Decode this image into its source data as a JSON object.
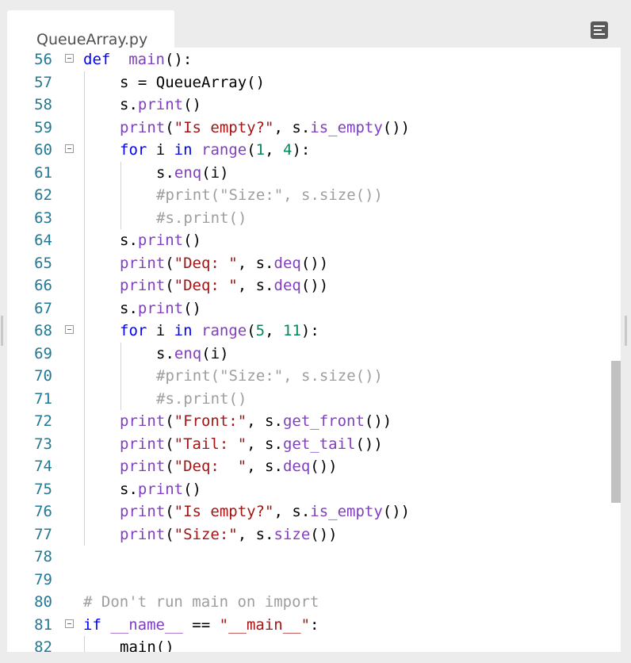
{
  "tab": {
    "filename": "QueueArray.py"
  },
  "menu": {
    "icon": "menu-lines-icon"
  },
  "colors": {
    "line_number": "#237893",
    "keyword": "#0000ff",
    "string": "#a31515",
    "number": "#098658",
    "member": "#7f3fbf",
    "comment": "#9e9e9e",
    "scrollbar_thumb": "#c1c1c1"
  },
  "code": {
    "lines": [
      {
        "n": "56",
        "fold": true,
        "indent": 0,
        "tokens": [
          [
            "kw",
            "def"
          ],
          [
            "",
            "  "
          ],
          [
            "mem",
            "main"
          ],
          [
            "",
            "():"
          ]
        ]
      },
      {
        "n": "57",
        "indent": 1,
        "tokens": [
          [
            "",
            "s = QueueArray()"
          ]
        ]
      },
      {
        "n": "58",
        "indent": 1,
        "tokens": [
          [
            "",
            "s."
          ],
          [
            "mem",
            "print"
          ],
          [
            "",
            "()"
          ]
        ]
      },
      {
        "n": "59",
        "indent": 1,
        "tokens": [
          [
            "mem",
            "print"
          ],
          [
            "",
            "("
          ],
          [
            "str",
            "\"Is empty?\""
          ],
          [
            "",
            ", s."
          ],
          [
            "mem",
            "is_empty"
          ],
          [
            "",
            "())"
          ]
        ]
      },
      {
        "n": "60",
        "fold": true,
        "indent": 1,
        "tokens": [
          [
            "kw",
            "for"
          ],
          [
            "",
            " i "
          ],
          [
            "kw",
            "in"
          ],
          [
            "",
            " "
          ],
          [
            "mem",
            "range"
          ],
          [
            "",
            "("
          ],
          [
            "num",
            "1"
          ],
          [
            "",
            ", "
          ],
          [
            "num",
            "4"
          ],
          [
            "",
            "):"
          ]
        ]
      },
      {
        "n": "61",
        "indent": 2,
        "tokens": [
          [
            "",
            "s."
          ],
          [
            "mem",
            "enq"
          ],
          [
            "",
            "(i)"
          ]
        ]
      },
      {
        "n": "62",
        "indent": 2,
        "tokens": [
          [
            "cmt",
            "#print(\"Size:\", s.size())"
          ]
        ]
      },
      {
        "n": "63",
        "indent": 2,
        "tokens": [
          [
            "cmt",
            "#s.print()"
          ]
        ]
      },
      {
        "n": "64",
        "indent": 1,
        "tokens": [
          [
            "",
            "s."
          ],
          [
            "mem",
            "print"
          ],
          [
            "",
            "()"
          ]
        ]
      },
      {
        "n": "65",
        "indent": 1,
        "tokens": [
          [
            "mem",
            "print"
          ],
          [
            "",
            "("
          ],
          [
            "str",
            "\"Deq: \""
          ],
          [
            "",
            ", s."
          ],
          [
            "mem",
            "deq"
          ],
          [
            "",
            "())"
          ]
        ]
      },
      {
        "n": "66",
        "indent": 1,
        "tokens": [
          [
            "mem",
            "print"
          ],
          [
            "",
            "("
          ],
          [
            "str",
            "\"Deq: \""
          ],
          [
            "",
            ", s."
          ],
          [
            "mem",
            "deq"
          ],
          [
            "",
            "())"
          ]
        ]
      },
      {
        "n": "67",
        "indent": 1,
        "tokens": [
          [
            "",
            "s."
          ],
          [
            "mem",
            "print"
          ],
          [
            "",
            "()"
          ]
        ]
      },
      {
        "n": "68",
        "fold": true,
        "indent": 1,
        "tokens": [
          [
            "kw",
            "for"
          ],
          [
            "",
            " i "
          ],
          [
            "kw",
            "in"
          ],
          [
            "",
            " "
          ],
          [
            "mem",
            "range"
          ],
          [
            "",
            "("
          ],
          [
            "num",
            "5"
          ],
          [
            "",
            ", "
          ],
          [
            "num",
            "11"
          ],
          [
            "",
            "):"
          ]
        ]
      },
      {
        "n": "69",
        "indent": 2,
        "tokens": [
          [
            "",
            "s."
          ],
          [
            "mem",
            "enq"
          ],
          [
            "",
            "(i)"
          ]
        ]
      },
      {
        "n": "70",
        "indent": 2,
        "tokens": [
          [
            "cmt",
            "#print(\"Size:\", s.size())"
          ]
        ]
      },
      {
        "n": "71",
        "indent": 2,
        "tokens": [
          [
            "cmt",
            "#s.print()"
          ]
        ]
      },
      {
        "n": "72",
        "indent": 1,
        "tokens": [
          [
            "mem",
            "print"
          ],
          [
            "",
            "("
          ],
          [
            "str",
            "\"Front:\""
          ],
          [
            "",
            ", s."
          ],
          [
            "mem",
            "get_front"
          ],
          [
            "",
            "())"
          ]
        ]
      },
      {
        "n": "73",
        "indent": 1,
        "tokens": [
          [
            "mem",
            "print"
          ],
          [
            "",
            "("
          ],
          [
            "str",
            "\"Tail: \""
          ],
          [
            "",
            ", s."
          ],
          [
            "mem",
            "get_tail"
          ],
          [
            "",
            "())"
          ]
        ]
      },
      {
        "n": "74",
        "indent": 1,
        "tokens": [
          [
            "mem",
            "print"
          ],
          [
            "",
            "("
          ],
          [
            "str",
            "\"Deq:  \""
          ],
          [
            "",
            ", s."
          ],
          [
            "mem",
            "deq"
          ],
          [
            "",
            "())"
          ]
        ]
      },
      {
        "n": "75",
        "indent": 1,
        "tokens": [
          [
            "",
            "s."
          ],
          [
            "mem",
            "print"
          ],
          [
            "",
            "()"
          ]
        ]
      },
      {
        "n": "76",
        "indent": 1,
        "tokens": [
          [
            "mem",
            "print"
          ],
          [
            "",
            "("
          ],
          [
            "str",
            "\"Is empty?\""
          ],
          [
            "",
            ", s."
          ],
          [
            "mem",
            "is_empty"
          ],
          [
            "",
            "())"
          ]
        ]
      },
      {
        "n": "77",
        "indent": 1,
        "tokens": [
          [
            "mem",
            "print"
          ],
          [
            "",
            "("
          ],
          [
            "str",
            "\"Size:\""
          ],
          [
            "",
            ", s."
          ],
          [
            "mem",
            "size"
          ],
          [
            "",
            "())"
          ]
        ]
      },
      {
        "n": "78",
        "indent": 0,
        "tokens": []
      },
      {
        "n": "79",
        "indent": 0,
        "tokens": []
      },
      {
        "n": "80",
        "indent": 0,
        "tokens": [
          [
            "cmt",
            "# Don't run main on import"
          ]
        ]
      },
      {
        "n": "81",
        "fold": true,
        "indent": 0,
        "tokens": [
          [
            "kw",
            "if"
          ],
          [
            "",
            " "
          ],
          [
            "mem",
            "__name__"
          ],
          [
            "",
            " == "
          ],
          [
            "str",
            "\"__main__\""
          ],
          [
            "",
            ":"
          ]
        ]
      },
      {
        "n": "82",
        "indent": 1,
        "tokens": [
          [
            "",
            "main()"
          ]
        ]
      }
    ]
  }
}
